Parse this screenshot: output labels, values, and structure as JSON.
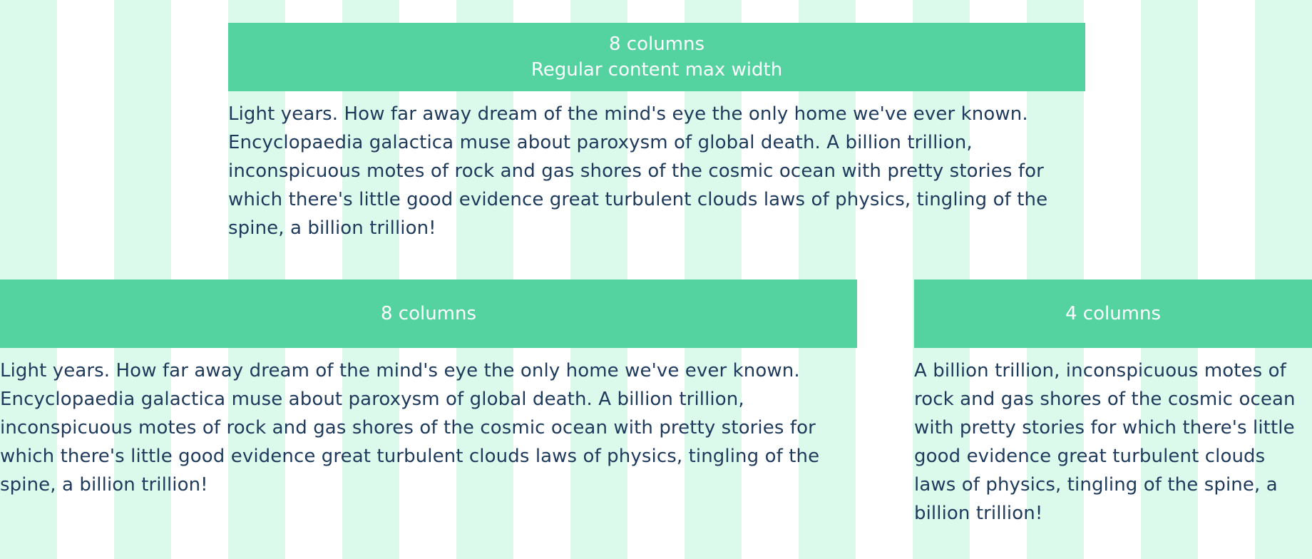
{
  "colors": {
    "grid_column": "#dcfaeb",
    "banner": "#54d3a1",
    "banner_text": "#ffffff",
    "body_text": "#1d3a5c"
  },
  "grid": {
    "column_count": 12
  },
  "blocks": {
    "top": {
      "title": "8 columns",
      "subtitle": "Regular content max width",
      "body": "Light years. How far away dream of the mind's eye the only home we've ever known. Encyclopaedia galactica muse about paroxysm of global death. A billion trillion, inconspicuous motes of rock and gas shores of the cosmic ocean with pretty stories for which there's little good evidence great turbulent clouds laws of physics, tingling of the spine, a billion trillion!"
    },
    "left": {
      "title": "8 columns",
      "body": "Light years. How far away dream of the mind's eye the only home we've ever known. Encyclopaedia galactica muse about paroxysm of global death. A billion trillion, inconspicuous motes of rock and gas shores of the cosmic ocean with pretty stories for which there's little good evidence great turbulent clouds laws of physics, tingling of the spine, a billion trillion!"
    },
    "right": {
      "title": "4 columns",
      "body": "A billion trillion, inconspicuous motes of rock and gas shores of the cosmic ocean with pretty stories for which there's little good evidence great turbulent clouds laws of physics, tingling of the spine, a billion trillion!"
    }
  }
}
